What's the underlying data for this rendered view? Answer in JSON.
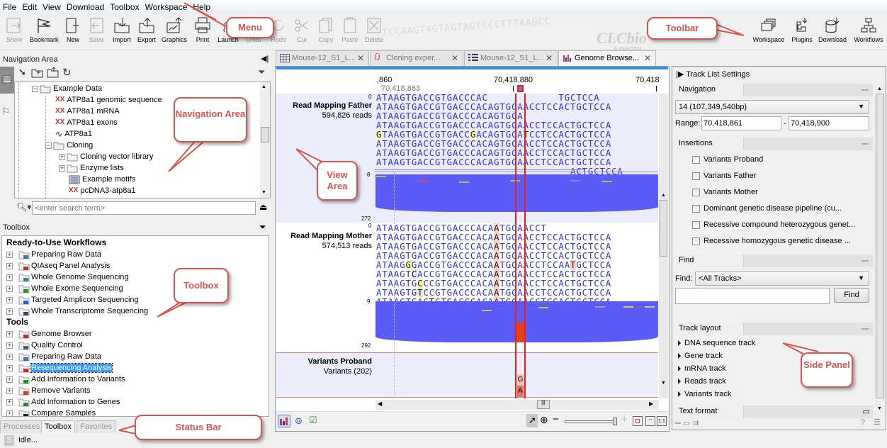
{
  "menu": [
    "File",
    "Edit",
    "View",
    "Download",
    "Toolbox",
    "Workspace",
    "Help"
  ],
  "toolbar": {
    "buttons": [
      {
        "label": "Show",
        "icon": "show-icon",
        "enabled": false
      },
      {
        "label": "Bookmark",
        "icon": "bookmark-flag-icon",
        "enabled": true
      },
      {
        "label": "New",
        "icon": "new-icon",
        "enabled": true
      },
      {
        "label": "Save",
        "icon": "save-icon",
        "enabled": false
      },
      {
        "label": "Import",
        "icon": "import-icon",
        "enabled": true
      },
      {
        "label": "Export",
        "icon": "export-icon",
        "enabled": true
      },
      {
        "label": "Graphics",
        "icon": "graphics-icon",
        "enabled": true
      },
      {
        "label": "Print",
        "icon": "print-icon",
        "enabled": true
      },
      {
        "label": "Launch",
        "icon": "launch-icon",
        "enabled": true
      },
      {
        "label": "Undo",
        "icon": "undo-icon",
        "enabled": false
      },
      {
        "label": "Redo",
        "icon": "redo-icon",
        "enabled": false
      },
      {
        "label": "Cut",
        "icon": "cut-icon",
        "enabled": false
      },
      {
        "label": "Copy",
        "icon": "copy-icon",
        "enabled": false
      },
      {
        "label": "Paste",
        "icon": "paste-icon",
        "enabled": false
      },
      {
        "label": "Delete",
        "icon": "delete-icon",
        "enabled": false
      }
    ],
    "right_buttons": [
      {
        "label": "Workspace",
        "icon": "workspace-icon"
      },
      {
        "label": "Plugins",
        "icon": "plugins-icon"
      },
      {
        "label": "Download",
        "icon": "download-icon"
      },
      {
        "label": "Workflows",
        "icon": "workflows-icon"
      }
    ],
    "logo": "CLCbio",
    "logo_sub": "A QIAGEN",
    "watermark": "TCCAAGTAGTAGTAGTCCCTTTAAGCC"
  },
  "navigation": {
    "title": "Navigation Area",
    "tree": [
      {
        "label": "Example Data",
        "icon": "folder-open-icon",
        "expander": "-"
      },
      {
        "label": "ATP8a1 genomic sequence",
        "icon": "sequence-icon"
      },
      {
        "label": "ATP8a1 mRNA",
        "icon": "sequence-icon"
      },
      {
        "label": "ATP8a1 exons",
        "icon": "sequence-icon"
      },
      {
        "label": "ATP8a1",
        "icon": "protein-icon"
      },
      {
        "label": "Cloning",
        "icon": "folder-open-icon",
        "expander": "-"
      },
      {
        "label": "Cloning vector library",
        "icon": "folder-icon",
        "expander": "+"
      },
      {
        "label": "Enzyme lists",
        "icon": "folder-icon",
        "expander": "+"
      },
      {
        "label": "Example motifs",
        "icon": "motif-icon"
      },
      {
        "label": "pcDNA3-atp8a1",
        "icon": "sequence-icon"
      }
    ],
    "search_placeholder": "<enter search term>"
  },
  "toolbox": {
    "title": "Toolbox",
    "sections": [
      {
        "heading": "Ready-to-Use Workflows",
        "items": [
          "Preparing Raw Data",
          "QIAseq Panel Analysis",
          "Whole Genome Sequencing",
          "Whole Exome Sequencing",
          "Targeted Amplicon Sequencing",
          "Whole Transcriptome Sequencing"
        ]
      },
      {
        "heading": "Tools",
        "items": [
          "Genome Browser",
          "Quality Control",
          "Preparing Raw Data",
          "Resequencing Analysis",
          "Add Information to Variants",
          "Remove Variants",
          "Add Information to Genes",
          "Compare Samples"
        ]
      }
    ],
    "selected": "Resequencing Analysis"
  },
  "bottom_tabs": [
    "Processes",
    "Toolbox",
    "Favorites"
  ],
  "active_bottom_tab": "Toolbox",
  "status": {
    "icon_letter": "S",
    "text": "Idle..."
  },
  "editor_tabs": [
    {
      "label": "Mouse-12_S1_L...",
      "icon": "table-icon"
    },
    {
      "label": "Cloning exper...",
      "icon": "cloning-icon"
    },
    {
      "label": "Mouse-12_S1_L...",
      "icon": "list-icon"
    },
    {
      "label": "Genome Browse...",
      "icon": "genome-browser-icon",
      "active": true
    }
  ],
  "view": {
    "ruler": {
      "left": ",860",
      "center": "70,418,880",
      "right": "70,418",
      "position": "70,418,863"
    },
    "father": {
      "name": "Read Mapping Father",
      "reads": "594,826 reads",
      "scale_top": "0",
      "scale_mid": "8",
      "scale_bottom": "272",
      "rows": [
        "ATAAGTGACCGTGACCCAC            TGCTCCA",
        "ATAAGTGACCGTGACCCACAGTGCAACCTCCACTGCTCCA",
        "ATAAGTGACCGTGACCCACAGTGCA",
        "ATAAGTGACCGTGACCCACAGTGCAACCTCCACTGCTCCA",
        "GTAAGTGACCGTGACCGACAGTGCATCCTCCACTGCTCCA",
        "ATAAGTGACCGTGACCCACAGTGCAACCTCCACTGCTCCA",
        "ATAAGTGACCGTGACCCACAGTGCAACCTCCACTGCTCCA",
        "ATAAGTGACCGTGACCCACAGTGCAACCTCCACTGCTCCA",
        "                                 ACTGCTCCA"
      ]
    },
    "mother": {
      "name": "Read Mapping Mother",
      "reads": "574,513 reads",
      "scale_top": "0",
      "scale_mid": "9",
      "scale_bottom": "292",
      "rows": [
        "ATAAGTGACCGTGACCCACAATGCAACCT",
        "ATAAGTGACCGTGACCCACAATGCAACCTCCACTGCTCCA",
        "ATAAGTGACCGTGACCCACAATGCAACCTCCACTGCTCCA",
        "ATAAGTGACCGTGACCCACAATGCAACCTCCACTGCTCCA",
        "ATAAGGGACCGTGACCCACAATGCAACCTCCAATGCTCCA",
        "ATAAGTCACCGTGACCCACAATGCAACCTCCACTGCTCCA",
        "ATAAGTGCCCGTGACCCACAATGCAACCTCCACTGCTCCA",
        "ATAAGTGTCCGTGACCCACAATGCAACCTCCACTGCTCCA",
        "ATAAGTGACTGTGACCCACAATGCAACCTCCACTGCTCCA"
      ]
    },
    "variants": {
      "name": "Variants Proband",
      "count": "Variants (202)",
      "alleles": [
        "G",
        "A"
      ]
    },
    "colors": {
      "base": "#2e2ee0",
      "coverage": "#5b5bf8",
      "selection": "#e8201a",
      "variant_highlight": "#e8401f"
    }
  },
  "side_panel": {
    "title": "Track List Settings",
    "navigation": {
      "title": "Navigation",
      "chromosome": "14 (107,349,540bp)",
      "range_label": "Range:",
      "range_from": "70,418,861",
      "range_to": "70,418,900"
    },
    "insertions": {
      "title": "Insertions",
      "items": [
        "Variants Proband",
        "Variants Father",
        "Variants Mother",
        "Dominant genetic disease pipeline (cu...",
        "Recessive compound heterozygous genet...",
        "Recessive homozygous genetic disease ..."
      ]
    },
    "find": {
      "title": "Find",
      "label": "Find:",
      "scope": "<All Tracks>",
      "value": "",
      "button": "Find"
    },
    "track_layout": {
      "title": "Track layout",
      "items": [
        "DNA sequence track",
        "Gene track",
        "mRNA track",
        "Reads track",
        "Variants track"
      ]
    },
    "text_format": {
      "title": "Text format"
    },
    "help": "?"
  },
  "callouts": {
    "menu": "Menu",
    "toolbar": "Toolbar",
    "navigation": "Navigation Area",
    "view": "View Area",
    "toolbox": "Toolbox",
    "status": "Status Bar",
    "side": "Side Panel"
  }
}
